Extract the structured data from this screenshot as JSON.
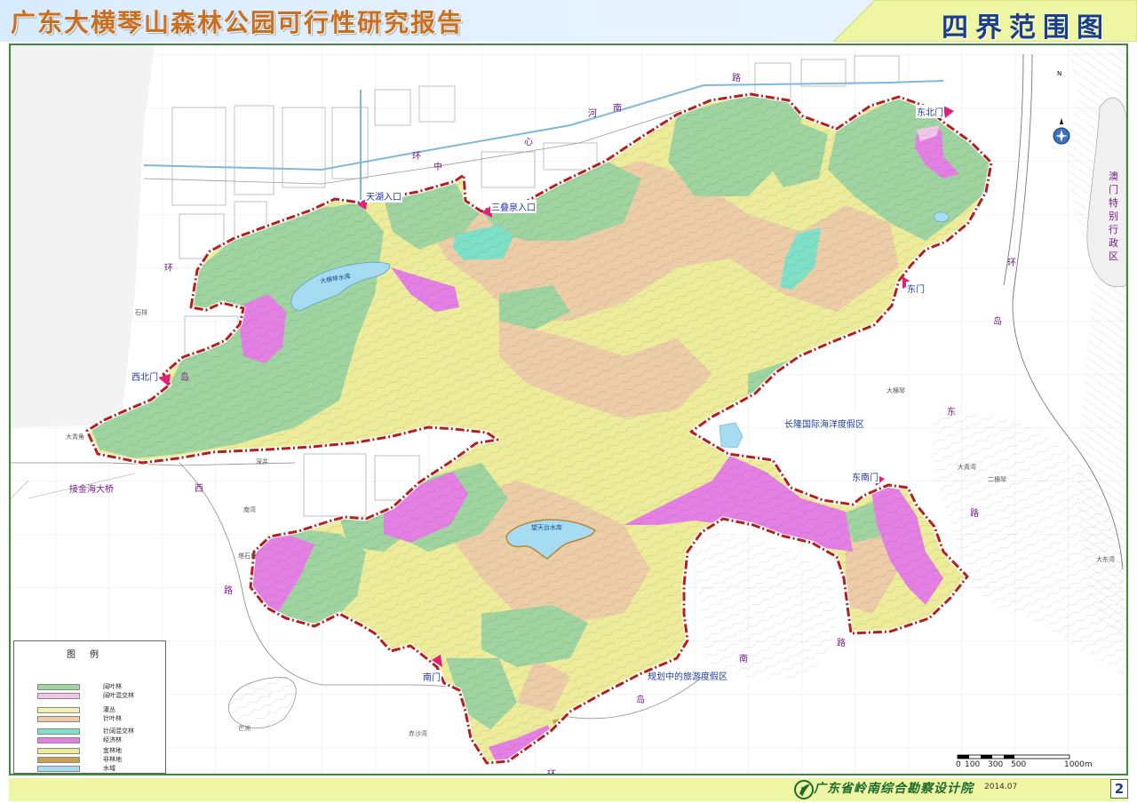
{
  "header": {
    "title": "广东大横琴山森林公园可行性研究报告",
    "map_title": "四界范围图"
  },
  "gates": {
    "north_gate_tianhu": "天湖入口",
    "north_gate_sandiequan": "三叠泉入口",
    "northeast_gate": "东北门",
    "east_gate": "东门",
    "southeast_gate": "东南门",
    "south_gate": "南门",
    "northwest_gate": "西北门"
  },
  "roads": {
    "north_ring_road": [
      "环",
      "中",
      "心",
      "南",
      "河",
      "路"
    ],
    "east_ring_road": [
      "环",
      "岛",
      "东",
      "路"
    ],
    "south_ring_road": [
      "南",
      "岛",
      "环"
    ],
    "west_ring_road": [
      "环",
      "岛",
      "西",
      "路"
    ]
  },
  "places": {
    "macau": "澳门特别行政区",
    "bridge": "接金海大桥",
    "resort": "长隆国际海洋度假区",
    "planned_resort": "规划中的旅游度假区"
  },
  "reservoirs": {
    "north": "大横琴水库",
    "south": "望天台水库"
  },
  "small_labels": [
    "大横琴",
    "二横琴",
    "大东湾",
    "大青角",
    "南湾",
    "赤沙湾",
    "深井",
    "塔石角",
    "芒洲",
    "石排",
    "大青湾"
  ],
  "legend": {
    "title": "图例",
    "items": [
      {
        "label": "阔叶林",
        "color": "#9fd3a0"
      },
      {
        "label": "阔叶混交林",
        "color": "#f2c6e6"
      },
      {
        "label": "灌丛",
        "color": "#f2efb2"
      },
      {
        "label": "针叶林",
        "color": "#edcca8"
      },
      {
        "label": "针阔混交林",
        "color": "#7fe0c8"
      },
      {
        "label": "经济林",
        "color": "#e480e4"
      },
      {
        "label": "宜林地",
        "color": "#ecec9a"
      },
      {
        "label": "非林地",
        "color": "#c8a050"
      },
      {
        "label": "水域",
        "color": "#a6dcf2"
      }
    ]
  },
  "scale": {
    "labels": [
      "0",
      "100",
      "300",
      "500",
      "1000m"
    ]
  },
  "compass": {
    "label": "N",
    "icon": "north-arrow-icon"
  },
  "footer": {
    "institute": "广东省岭南综合勘察设计院",
    "date": "2014.07",
    "page": "2"
  },
  "colors": {
    "boundary": "#b41e1e",
    "gate_arrow": "#e0207a",
    "header_start": "#cfe6ff",
    "header_end": "#f0f5a0",
    "frame": "#3d8a3d"
  }
}
